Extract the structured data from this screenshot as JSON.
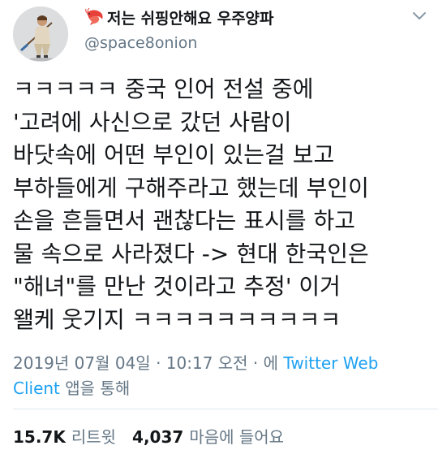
{
  "user": {
    "display_name": "저는 쉬핑안해요 우주양파",
    "handle": "@space8onion",
    "badge_icon": "shrimp-icon",
    "avatar_icon": "avatar-image"
  },
  "tweet": {
    "lines": [
      "ㅋㅋㅋㅋㅋ 중국 인어 전설 중에",
      "'고려에 사신으로 갔던 사람이",
      "바닷속에 어떤 부인이 있는걸 보고",
      "부하들에게 구해주라고 했는데 부인이",
      "손을 흔들면서 괜찮다는 표시를 하고",
      "물 속으로 사라졌다 -> 현대 한국인은",
      "\"해녀\"를 만난 것이라고 추정' 이거",
      "왤케 웃기지 ㅋㅋㅋㅋㅋㅋㅋㅋㅋㅋ"
    ]
  },
  "meta": {
    "timestamp": "2019년 07월 04일 · 10:17 오전 · 에",
    "via": "Twitter Web",
    "via_cont": "Client",
    "via_suffix": "앱을 통해"
  },
  "stats": {
    "retweets": "15.7K",
    "retweets_label": "리트윗",
    "likes": "4,037",
    "likes_label": "마음에 들어요"
  },
  "colors": {
    "text": "#14171a",
    "secondary": "#657786",
    "link": "#1da1f2",
    "divider": "#e1e8ed"
  }
}
